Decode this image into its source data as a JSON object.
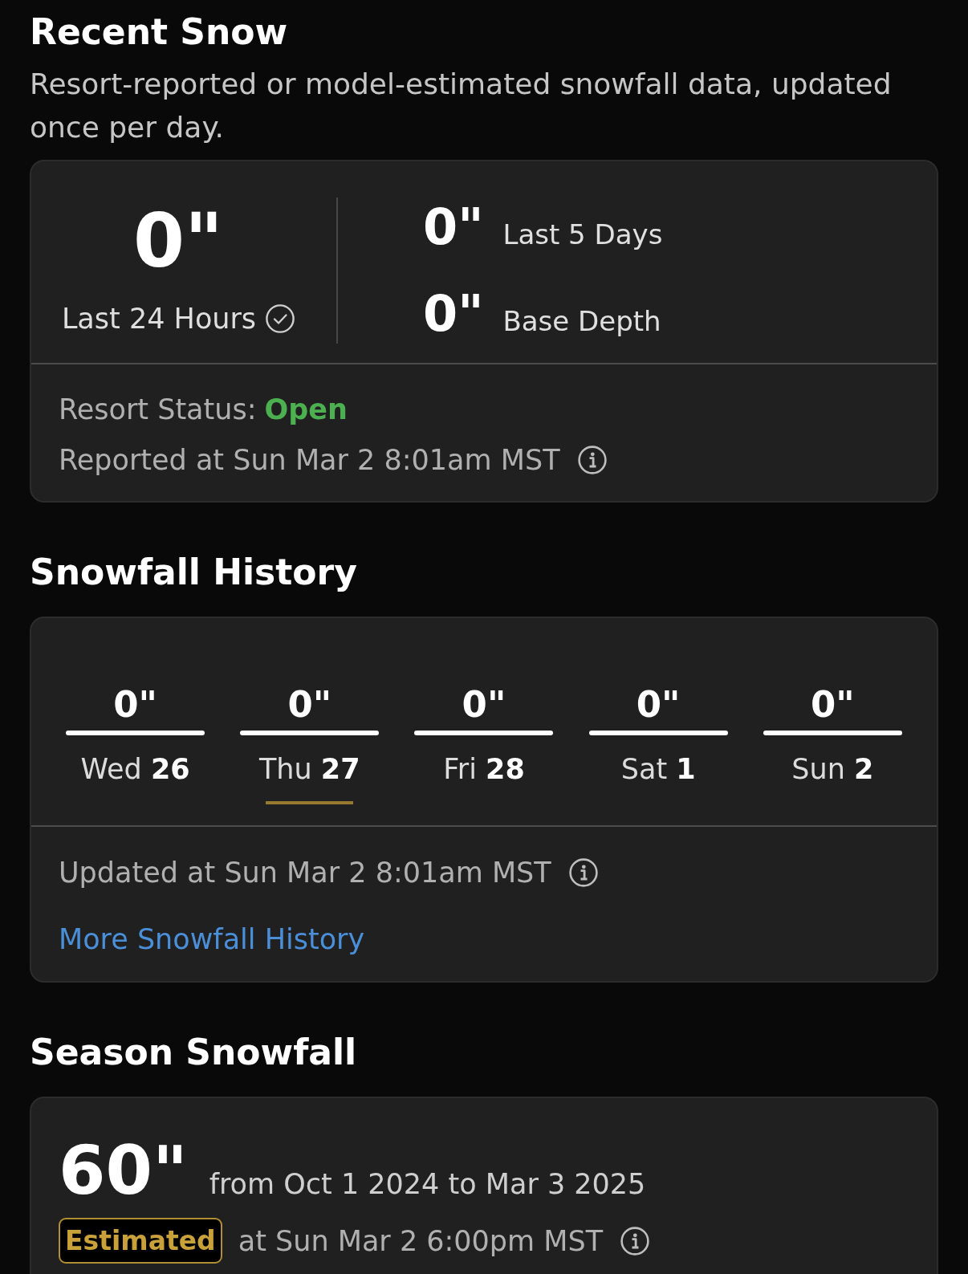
{
  "recent": {
    "title": "Recent Snow",
    "subtitle": "Resort-reported or model-estimated snowfall data, updated once per day.",
    "main": {
      "value": "0\"",
      "label": "Last 24 Hours",
      "verified": true
    },
    "stats": [
      {
        "value": "0\"",
        "label": "Last 5 Days"
      },
      {
        "value": "0\"",
        "label": "Base Depth"
      }
    ],
    "status": {
      "label": "Resort Status:",
      "value": "Open",
      "open": true
    },
    "reported": "Reported at Sun Mar 2 8:01am MST"
  },
  "history": {
    "title": "Snowfall History",
    "days": [
      {
        "value": "0\"",
        "label": "Wed **26**",
        "selected": false
      },
      {
        "value": "0\"",
        "label": "Thu **27**",
        "selected": true
      },
      {
        "value": "0\"",
        "label": "Fri **28**",
        "selected": false
      },
      {
        "value": "0\"",
        "label": "Sat **1**",
        "selected": false
      },
      {
        "value": "0\"",
        "label": "Sun **2**",
        "selected": false
      }
    ],
    "updated": "Updated at Sun Mar 2 8:01am MST",
    "link": "More Snowfall History"
  },
  "season": {
    "title": "Season Snowfall",
    "value": "60\"",
    "range": "from Oct 1 2024 to Mar 3 2025",
    "badge": "Estimated",
    "time": "at Sun Mar 2 6:00pm MST"
  }
}
